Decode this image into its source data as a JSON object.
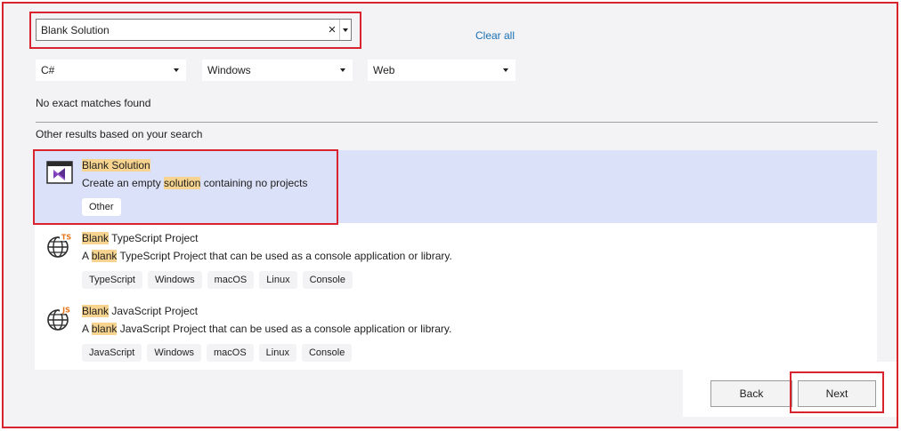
{
  "search": {
    "value": "Blank Solution",
    "clear_icon": "×"
  },
  "clear_all": "Clear all",
  "filters": [
    {
      "value": "C#"
    },
    {
      "value": "Windows"
    },
    {
      "value": "Web"
    }
  ],
  "messages": {
    "no_match": "No exact matches found",
    "other_results": "Other results based on your search"
  },
  "results": [
    {
      "title_hl": "Blank Solution",
      "title_rest": "",
      "desc_before": "Create an empty ",
      "desc_hl": "solution",
      "desc_after": " containing no projects",
      "tags": [
        "Other"
      ],
      "icon": "visual-studio-solution-icon"
    },
    {
      "title_hl": "Blank",
      "title_rest": " TypeScript Project",
      "desc_before": "A ",
      "desc_hl": "blank",
      "desc_after": " TypeScript Project that can be used as a console application or library.",
      "tags": [
        "TypeScript",
        "Windows",
        "macOS",
        "Linux",
        "Console"
      ],
      "icon": "typescript-globe-icon",
      "badge": "TS"
    },
    {
      "title_hl": "Blank",
      "title_rest": " JavaScript Project",
      "desc_before": "A ",
      "desc_hl": "blank",
      "desc_after": " JavaScript Project that can be used as a console application or library.",
      "tags": [
        "JavaScript",
        "Windows",
        "macOS",
        "Linux",
        "Console"
      ],
      "icon": "javascript-globe-icon",
      "badge": "JS"
    }
  ],
  "buttons": {
    "back": "Back",
    "next": "Next"
  },
  "colors": {
    "highlight_border": "#d9232e",
    "selected_bg": "#dbe1f8",
    "match_highlight": "#f6d38e",
    "link": "#1a6fb4"
  }
}
